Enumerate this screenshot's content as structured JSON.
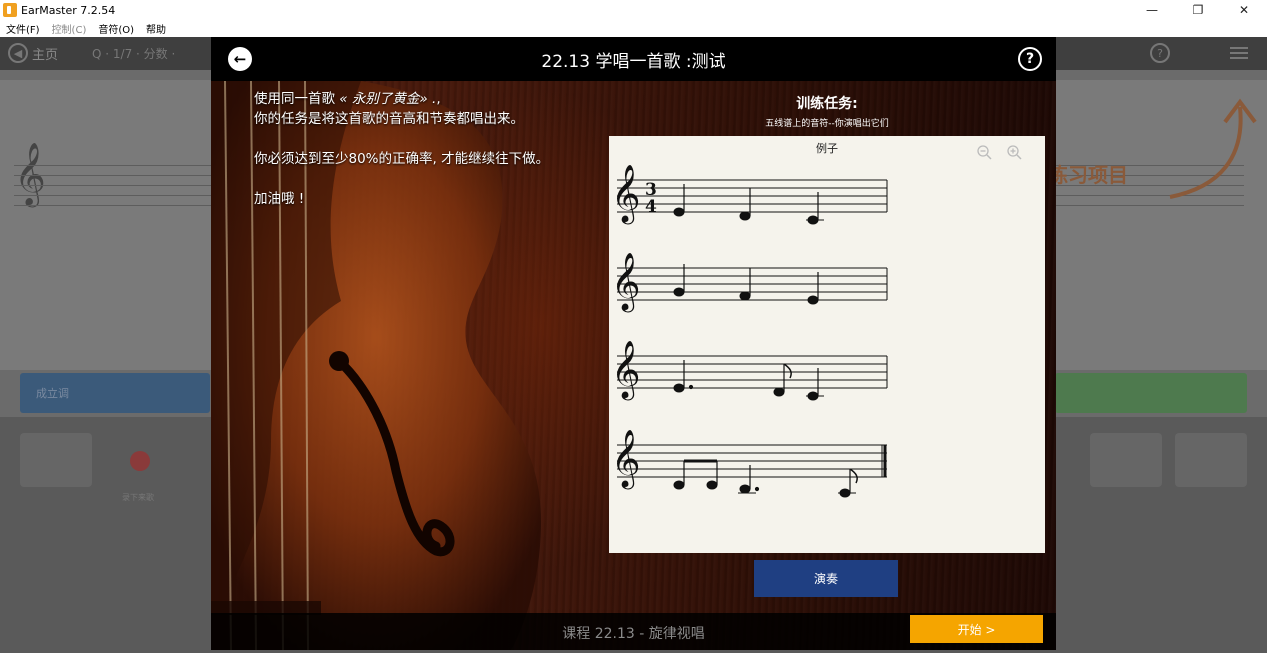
{
  "window": {
    "title": "EarMaster 7.2.54",
    "controls": {
      "minimize": "—",
      "restore": "❐",
      "close": "✕"
    }
  },
  "menu": {
    "items": [
      "文件(F)",
      "控制(C)",
      "音符(O)",
      "帮助"
    ]
  },
  "background": {
    "home_label": "主页",
    "score_label": "Q · 1/7 · 分数 ·",
    "blue_panel_label": "成立调",
    "practice_label": "练习项目",
    "tiles": [
      "",
      "录下来歌",
      "",
      ""
    ]
  },
  "modal": {
    "title": "22.13 学唱一首歌 :测试",
    "instructions": {
      "line1_prefix": "使用同一首歌",
      "song": "« 永别了黄金» .",
      "line1_suffix": ",",
      "line2": "你的任务是将这首歌的音高和节奏都唱出来。",
      "line3": "你必须达到至少80%的正确率, 才能继续往下做。",
      "line4": "加油哦 !"
    },
    "task": {
      "title": "训练任务:",
      "subtitle": "五线谱上的音符--你演唱出它们"
    },
    "sheet": {
      "label": "例子",
      "time_signature": {
        "top": "3",
        "bottom": "4"
      }
    },
    "play_button": "演奏",
    "lesson": "课程 22.13 - 旋律视唱",
    "start_button": "开始 >"
  }
}
